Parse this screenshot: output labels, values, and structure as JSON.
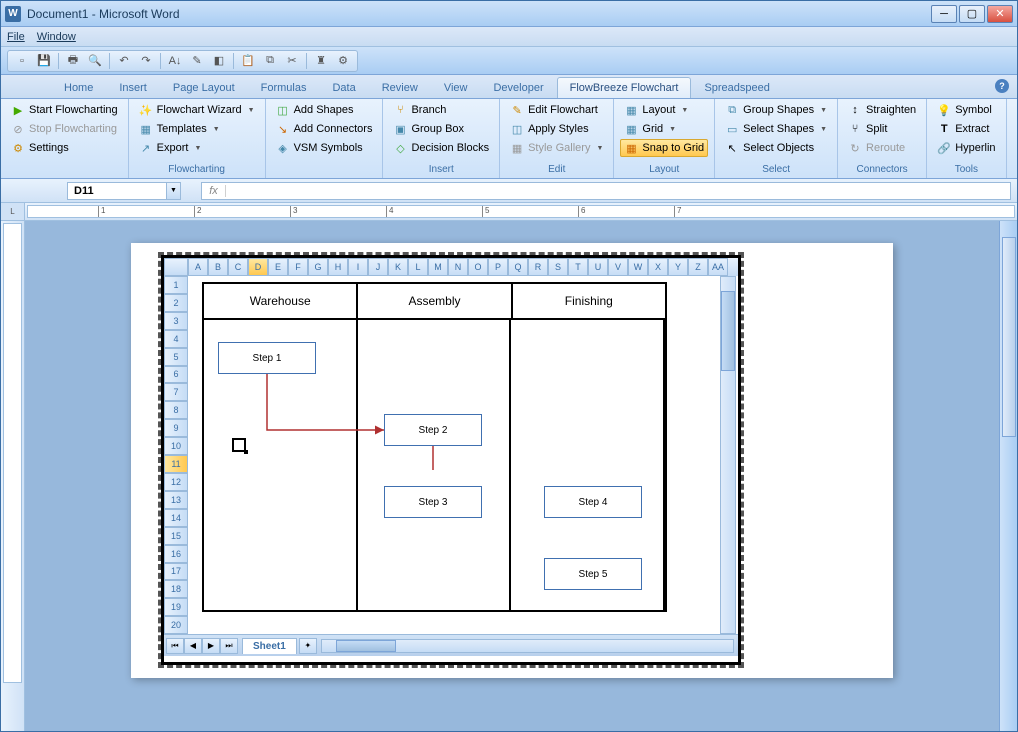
{
  "window": {
    "title": "Document1 - Microsoft Word"
  },
  "menu": {
    "file": "File",
    "window": "Window"
  },
  "tabs": {
    "home": "Home",
    "insert": "Insert",
    "pagelayout": "Page Layout",
    "formulas": "Formulas",
    "data": "Data",
    "review": "Review",
    "view": "View",
    "developer": "Developer",
    "flowbreeze": "FlowBreeze Flowchart",
    "spreadspeed": "Spreadspeed"
  },
  "ribbon": {
    "flowcharting": {
      "label": "Flowcharting",
      "start": "Start Flowcharting",
      "stop": "Stop Flowcharting",
      "settings": "Settings",
      "wizard": "Flowchart Wizard",
      "templates": "Templates",
      "export": "Export"
    },
    "insert": {
      "label": "Insert",
      "addshapes": "Add Shapes",
      "addconn": "Add Connectors",
      "vsm": "VSM Symbols",
      "branch": "Branch",
      "groupbox": "Group Box",
      "decision": "Decision Blocks"
    },
    "edit": {
      "label": "Edit",
      "editfc": "Edit Flowchart",
      "apply": "Apply Styles",
      "gallery": "Style Gallery"
    },
    "layout": {
      "label": "Layout",
      "layout": "Layout",
      "grid": "Grid",
      "snap": "Snap to Grid"
    },
    "select": {
      "label": "Select",
      "groupshapes": "Group Shapes",
      "selshapes": "Select Shapes",
      "selobj": "Select Objects"
    },
    "connectors": {
      "label": "Connectors",
      "straighten": "Straighten",
      "split": "Split",
      "reroute": "Reroute"
    },
    "tools": {
      "label": "Tools",
      "symbol": "Symbol",
      "extract": "Extract",
      "hyperlink": "Hyperlin"
    }
  },
  "cell": {
    "ref": "D11",
    "fx": "fx"
  },
  "sheet": {
    "name": "Sheet1"
  },
  "columns": [
    "A",
    "B",
    "C",
    "D",
    "E",
    "F",
    "G",
    "H",
    "I",
    "J",
    "K",
    "L",
    "M",
    "N",
    "O",
    "P",
    "Q",
    "R",
    "S",
    "T",
    "U",
    "V",
    "W",
    "X",
    "Y",
    "Z",
    "AA"
  ],
  "rows": [
    "1",
    "2",
    "3",
    "4",
    "5",
    "6",
    "7",
    "8",
    "9",
    "10",
    "11",
    "12",
    "13",
    "14",
    "15",
    "16",
    "17",
    "18",
    "19",
    "20"
  ],
  "swim": {
    "warehouse": "Warehouse",
    "assembly": "Assembly",
    "finishing": "Finishing",
    "step1": "Step 1",
    "step2": "Step 2",
    "step3": "Step 3",
    "step4": "Step 4",
    "step5": "Step 5"
  },
  "ruler": [
    "1",
    "2",
    "3",
    "4",
    "5",
    "6",
    "7"
  ]
}
